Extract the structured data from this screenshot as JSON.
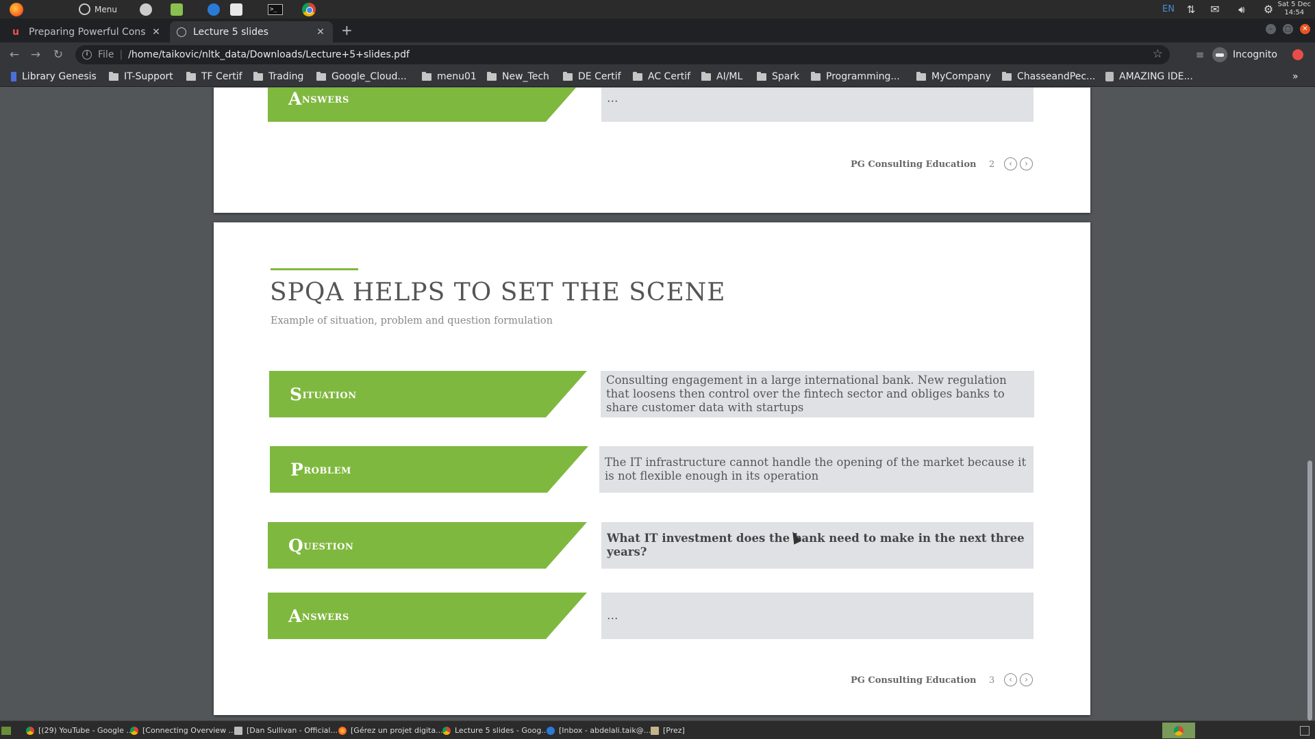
{
  "os_panel": {
    "menu_label": "Menu",
    "lang": "EN",
    "clock_line1": "Sat 5 Dec",
    "clock_line2": "14:54"
  },
  "tabs": [
    {
      "title": "Preparing Powerful Cons",
      "active": false
    },
    {
      "title": "Lecture 5 slides",
      "active": true
    }
  ],
  "toolbar": {
    "scheme_label": "File",
    "url": "/home/taikovic/nltk_data/Downloads/Lecture+5+slides.pdf",
    "incognito_label": "Incognito"
  },
  "bookmarks": [
    "Library Genesis",
    "IT-Support",
    "TF Certif",
    "Trading",
    "Google_Cloud...",
    "menu01",
    "New_Tech",
    "DE Certif",
    "AC Certif",
    "AI/ML",
    "Spark",
    "Programming...",
    "MyCompany",
    "ChasseandPec...",
    "AMAZING IDE..."
  ],
  "pdf": {
    "page2": {
      "answers_label_first": "A",
      "answers_label_rest": "NSWERS",
      "answers_text": "…",
      "footer": "PG Consulting Education",
      "page_number": "2"
    },
    "page3": {
      "title": "SPQA HELPS TO SET THE SCENE",
      "subtitle": "Example of situation, problem and question formulation",
      "rows": [
        {
          "label_first": "S",
          "label_rest": "ITUATION",
          "text": "Consulting engagement in a large international bank. New regulation that loosens then control over the fintech sector and obliges banks to share customer data with startups"
        },
        {
          "label_first": "P",
          "label_rest": "ROBLEM",
          "text": "The IT infrastructure cannot handle the opening of the market because it is not flexible enough in its operation"
        },
        {
          "label_first": "Q",
          "label_rest": "UESTION",
          "text": "What IT investment does the bank need to make in the next three years?"
        },
        {
          "label_first": "A",
          "label_rest": "NSWERS",
          "text": "…"
        }
      ],
      "footer": "PG Consulting Education",
      "page_number": "3"
    }
  },
  "taskbar": [
    "[(29) YouTube - Google ...",
    "[Connecting Overview ...",
    "[Dan Sullivan - Official...",
    "[Gérez un projet digita...",
    "Lecture 5 slides - Goog...",
    "[Inbox - abdelali.taik@...",
    "[Prez]"
  ],
  "colors": {
    "accent_green": "#7fb83f",
    "answer_box": "#dfe1e4"
  }
}
